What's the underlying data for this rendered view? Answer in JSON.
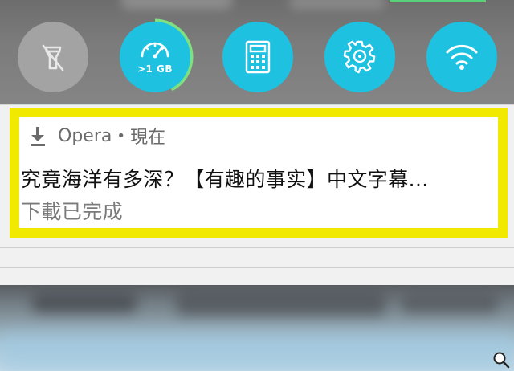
{
  "quick_settings": {
    "data_usage_label": ">1 GB",
    "colors": {
      "active": "#1fc1e0",
      "inactive": "#a3a3a3",
      "ring": "#7ee07e"
    },
    "tiles": [
      {
        "icon": "flashlight-off-icon",
        "state": "off"
      },
      {
        "icon": "data-usage-icon",
        "state": "on"
      },
      {
        "icon": "calculator-icon",
        "state": "on"
      },
      {
        "icon": "settings-icon",
        "state": "on"
      },
      {
        "icon": "wifi-icon",
        "state": "on"
      }
    ]
  },
  "notification": {
    "icon": "download-icon",
    "app_name": "Opera",
    "separator": "•",
    "time": "現在",
    "title": "究竟海洋有多深？【有趣的事实】中文字幕...",
    "text": "下載已完成",
    "highlight_color": "#f1ea00"
  },
  "overlay": {
    "icon": "zoom-icon"
  }
}
